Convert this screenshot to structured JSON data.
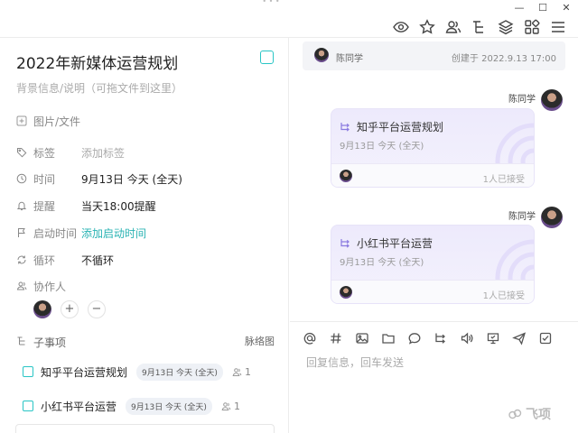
{
  "titlebar": {
    "minimize_glyph": "—",
    "maximize_glyph": "☐",
    "close_glyph": "✕"
  },
  "toolbar": {
    "icons": [
      "eye-icon",
      "star-icon",
      "members-icon",
      "subtask-tree-icon",
      "layers-icon",
      "apps-grid-icon",
      "menu-icon"
    ]
  },
  "task": {
    "title": "2022年新媒体运营规划",
    "description_placeholder": "背景信息/说明（可拖文件到这里）",
    "attachments_label": "图片/文件",
    "fields": {
      "tag": {
        "label": "标签",
        "value": "添加标签"
      },
      "time": {
        "label": "时间",
        "value": "9月13日 今天 (全天)"
      },
      "reminder": {
        "label": "提醒",
        "value": "当天18:00提醒"
      },
      "start_time": {
        "label": "启动时间",
        "value": "添加启动时间"
      },
      "repeat": {
        "label": "循环",
        "value": "不循环"
      }
    },
    "collaborators_label": "协作人",
    "add_collaborator": "+",
    "remove_collaborator": "−",
    "subtasks_label": "子事项",
    "subtasks_view": "脉络图",
    "subtasks": [
      {
        "name": "知乎平台运营规划",
        "date": "9月13日 今天 (全天)",
        "people": "1"
      },
      {
        "name": "小红书平台运营",
        "date": "9月13日 今天 (全天)",
        "people": "1"
      }
    ]
  },
  "chat": {
    "created": {
      "user": "陈同学",
      "text": "创建于 2022.9.13 17:00"
    },
    "messages": [
      {
        "sender": "陈同学",
        "card_title": "知乎平台运营规划",
        "card_date": "9月13日 今天 (全天)",
        "accepted": "1人已接受"
      },
      {
        "sender": "陈同学",
        "card_title": "小红书平台运营",
        "card_date": "9月13日 今天 (全天)",
        "accepted": "1人已接受"
      }
    ],
    "composer": {
      "icons": [
        "at-icon",
        "hashtag-icon",
        "image-icon",
        "folder-icon",
        "chat-bubble-icon",
        "subtask-icon",
        "voice-icon",
        "screenshot-icon",
        "send-icon",
        "checklist-icon"
      ],
      "placeholder": "回复信息，回车发送"
    }
  },
  "watermark": {
    "text": "飞项"
  },
  "colors": {
    "accent": "#29c5c5",
    "card_bg": "#edeafc",
    "card_icon": "#8a7ae0"
  }
}
